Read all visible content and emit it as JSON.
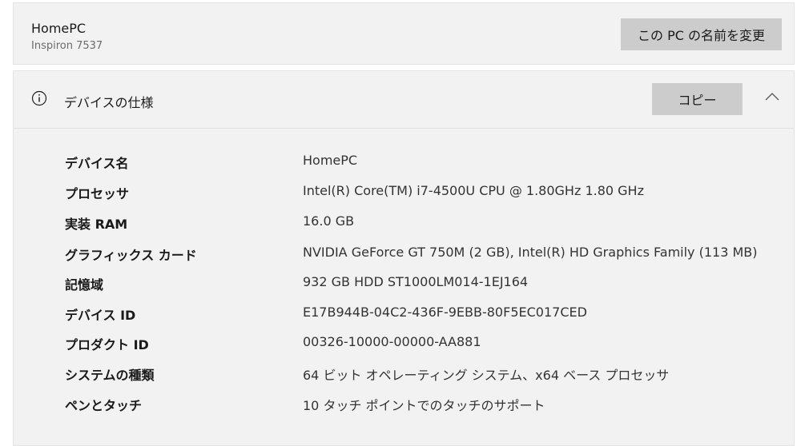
{
  "device": {
    "name": "HomePC",
    "model": "Inspiron 7537",
    "rename_label": "この PC の名前を変更"
  },
  "specs": {
    "title": "デバイスの仕様",
    "copy_label": "コピー",
    "rows": [
      {
        "label": "デバイス名",
        "value": "HomePC"
      },
      {
        "label": "プロセッサ",
        "value": "Intel(R) Core(TM) i7-4500U CPU @ 1.80GHz   1.80 GHz"
      },
      {
        "label": "実装 RAM",
        "value": "16.0 GB"
      },
      {
        "label": "グラフィックス カード",
        "value": "NVIDIA GeForce GT 750M (2 GB), Intel(R) HD Graphics Family (113 MB)"
      },
      {
        "label": "記憶域",
        "value": "932 GB HDD ST1000LM014-1EJ164"
      },
      {
        "label": "デバイス ID",
        "value": "E17B944B-04C2-436F-9EBB-80F5EC017CED"
      },
      {
        "label": "プロダクト ID",
        "value": "00326-10000-00000-AA881"
      },
      {
        "label": "システムの種類",
        "value": "64 ビット オペレーティング システム、x64 ベース プロセッサ"
      },
      {
        "label": "ペンとタッチ",
        "value": "10 タッチ ポイントでのタッチのサポート"
      }
    ]
  },
  "icons": {
    "info": "info-icon",
    "collapse": "chevron-up-icon"
  }
}
